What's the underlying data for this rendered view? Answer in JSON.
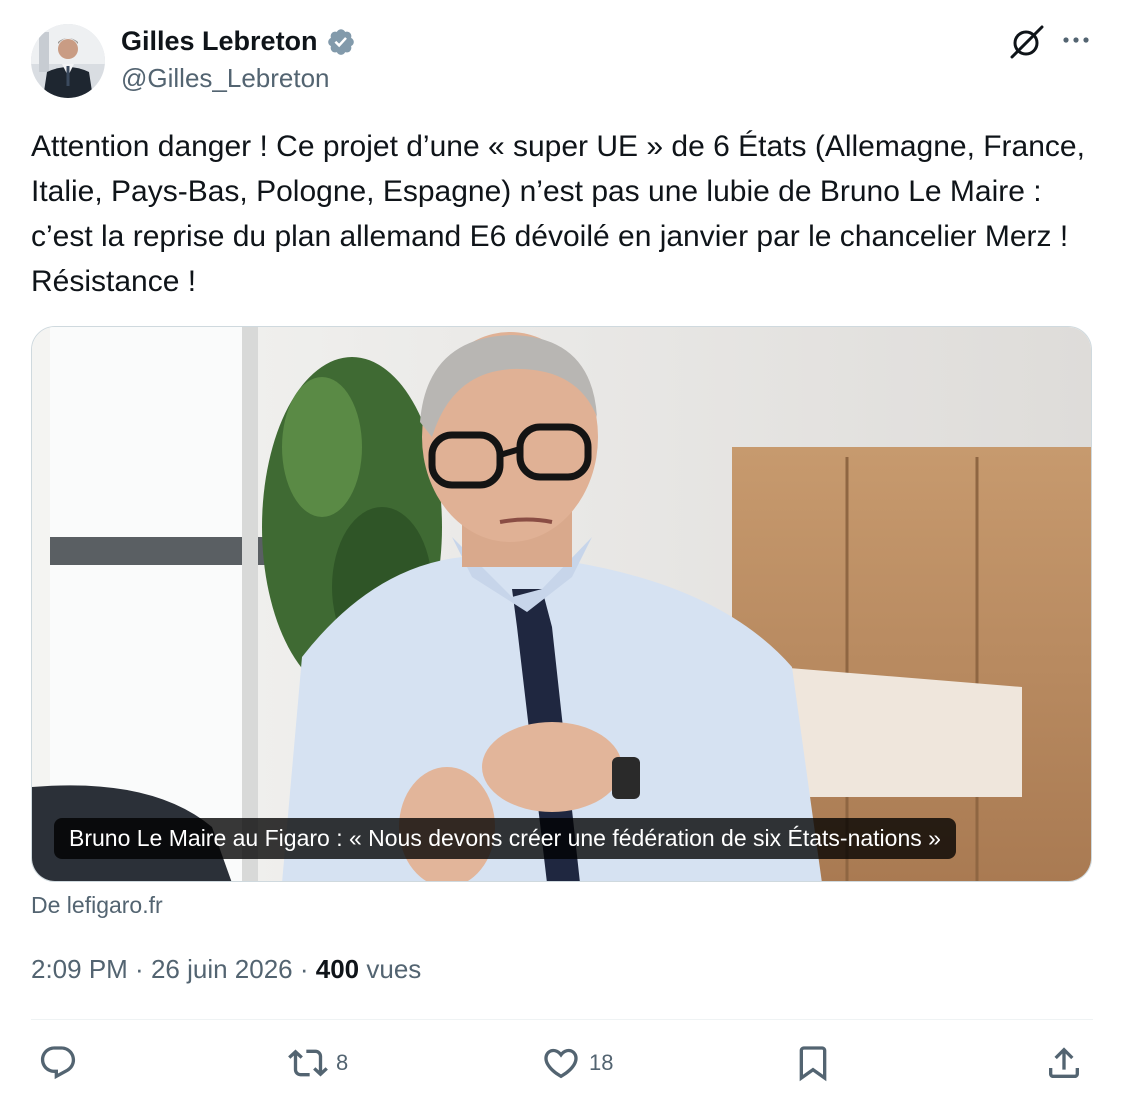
{
  "author": {
    "name": "Gilles Lebreton",
    "handle": "@Gilles_Lebreton",
    "verified_color": "#829aab"
  },
  "header_icons": {
    "grok": "grok-icon",
    "more": "more-icon"
  },
  "tweet": {
    "text": "Attention danger ! Ce projet d’une « super UE » de 6 États (Allemagne, France, Italie, Pays-Bas, Pologne, Espagne) n’est pas une lubie de Bruno Le Maire : c’est la reprise du plan allemand E6 dévoilé en janvier par le chancelier Merz ! Résistance !"
  },
  "card": {
    "caption": "Bruno Le Maire au Figaro : « Nous devons créer une fédération de six États-nations »",
    "source": "De lefigaro.fr"
  },
  "meta": {
    "time": "2:09 PM",
    "separator": " · ",
    "date": "26 juin 2026",
    "views_count": "400",
    "views_label": "vues"
  },
  "actions": {
    "reply_icon": "reply-icon",
    "retweet_icon": "retweet-icon",
    "retweet_count": "8",
    "like_icon": "heart-icon",
    "like_count": "18",
    "bookmark_icon": "bookmark-icon",
    "share_icon": "share-icon"
  },
  "colors": {
    "text_primary": "#0f1419",
    "text_secondary": "#536471",
    "border": "#cfd9de"
  }
}
